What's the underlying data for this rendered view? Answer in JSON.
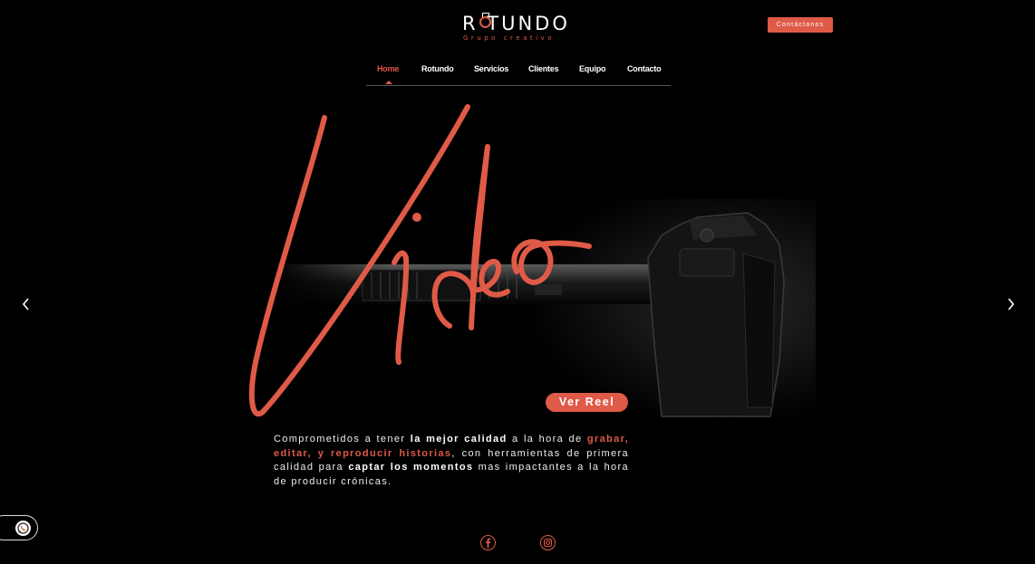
{
  "brand": {
    "name": "R TUNDO",
    "tagline": "Grupo creativo",
    "accent": "#e05a48"
  },
  "header": {
    "contact_label": "Contáctanos"
  },
  "nav": {
    "items": [
      {
        "label": "Home",
        "active": true
      },
      {
        "label": "Rotundo"
      },
      {
        "label": "Servicios"
      },
      {
        "label": "Clientes"
      },
      {
        "label": "Equipo"
      },
      {
        "label": "Contacto"
      }
    ]
  },
  "hero": {
    "script_word": "Video",
    "reel_label": "Ver Reel",
    "desc_1": "Comprometidos a tener ",
    "desc_2": "la mejor calidad",
    "desc_3": " a la hora de ",
    "desc_4": "grabar, editar, y reproducir historias",
    "desc_5": ", con herramientas de primera calidad para ",
    "desc_6": "captar los momentos",
    "desc_7": " mas impactantes a la hora de producir crónicas."
  },
  "icons": {
    "prev": "chevron-left-icon",
    "next": "chevron-right-icon",
    "whatsapp": "whatsapp-icon",
    "facebook": "facebook-icon",
    "instagram": "instagram-icon"
  }
}
